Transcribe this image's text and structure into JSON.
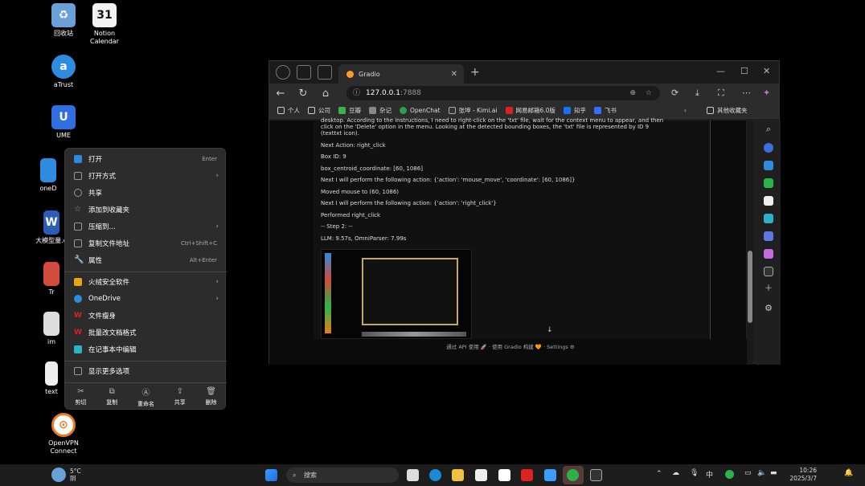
{
  "desktop_icons": [
    {
      "label": "回收站",
      "color": "#6aa0d8",
      "glyph": "recycle-bin-icon"
    },
    {
      "label": "Notion Calendar",
      "color": "#f2f2f2",
      "glyph": "31"
    },
    {
      "label": "aTrust",
      "color": "#2d8be0",
      "glyph": "a"
    },
    {
      "label": "UME",
      "color": "#2f6fe0",
      "glyph": "U"
    },
    {
      "label": "oneD",
      "color": "#2d8be0"
    },
    {
      "label": "大模型量.d",
      "color": "#2b5fb5"
    },
    {
      "label": "Tr",
      "color": "#d24b3c"
    },
    {
      "label": "im",
      "color": "#ddd"
    },
    {
      "label": "text",
      "color": "#eee"
    },
    {
      "label": "OpenVPN Connect",
      "color": "#ea7a1c"
    }
  ],
  "browser": {
    "tab_title": "Gradio",
    "url_host": "127.0.0.1",
    "url_port": ":7888",
    "favorites": [
      {
        "label": "个人",
        "color": "#ccc"
      },
      {
        "label": "公司",
        "color": "#ccc"
      },
      {
        "label": "豆瓣",
        "color": "#3bb34a"
      },
      {
        "label": "杂记",
        "color": "#888"
      },
      {
        "label": "OpenChat",
        "color": "#2aa14f"
      },
      {
        "label": "张坤 - Kimi.ai",
        "color": "#333"
      },
      {
        "label": "网易邮箱6.0版",
        "color": "#d22"
      },
      {
        "label": "知乎",
        "color": "#1772f6"
      },
      {
        "label": "飞书",
        "color": "#3370ff"
      }
    ],
    "favorites_other": "其他收藏夹",
    "log": [
      "desktop. According to the instructions, I need to right-click on the 'txt' file, wait for the context menu to appear, and then click on the 'Delete' option in the menu. Looking at the detected bounding boxes, the 'txt' file is represented by ID 9 (texttxt icon).",
      "Next Action: right_click",
      "Box ID: 9",
      "box_centroid_coordinate: [60, 1086]",
      "Next I will perform the following action: {'action': 'mouse_move', 'coordinate': [60, 1086]}",
      "Moved mouse to (60, 1086)",
      "Next I will perform the following action: {'action': 'right_click'}",
      "Performed right_click",
      "-- Step 2: --",
      "LLM: 9.57s, OmniParser: 7.99s"
    ],
    "footer": "通过 API 使用 🚀 · 使用 Gradio 构建 🧡 · Settings ⚙"
  },
  "context_menu": {
    "items": [
      {
        "label": "打开",
        "shortcut": "Enter",
        "color": "#2b8be0"
      },
      {
        "label": "打开方式",
        "arrow": "›",
        "color": "#999"
      },
      {
        "label": "共享",
        "color": "#999"
      },
      {
        "label": "添加到收藏夹",
        "color": "#999"
      },
      {
        "label": "压缩到...",
        "arrow": "›",
        "color": "#999"
      },
      {
        "label": "复制文件地址",
        "shortcut": "Ctrl+Shift+C",
        "color": "#999"
      },
      {
        "label": "属性",
        "shortcut": "Alt+Enter",
        "color": "#999"
      },
      {
        "label": "火绒安全软件",
        "arrow": "›",
        "color": "#e8a317"
      },
      {
        "label": "OneDrive",
        "arrow": "›",
        "color": "#2d8be0"
      },
      {
        "label": "文件瘦身",
        "color": "#d22"
      },
      {
        "label": "批量改文档格式",
        "color": "#d22"
      },
      {
        "label": "在记事本中编辑",
        "color": "#2bb3c9"
      },
      {
        "label": "显示更多选项",
        "color": "#999"
      }
    ],
    "bar": [
      {
        "label": "剪切",
        "glyph": "✂"
      },
      {
        "label": "复制",
        "glyph": "⧉"
      },
      {
        "label": "重命名",
        "glyph": "Ⓐ"
      },
      {
        "label": "共享",
        "glyph": "⇪"
      },
      {
        "label": "删除",
        "glyph": "🗑"
      }
    ]
  },
  "taskbar": {
    "weather_temp": "5°C",
    "weather_desc": "阴",
    "search_placeholder": "搜索",
    "ime": "中",
    "time": "10:26",
    "date": "2025/3/7"
  }
}
